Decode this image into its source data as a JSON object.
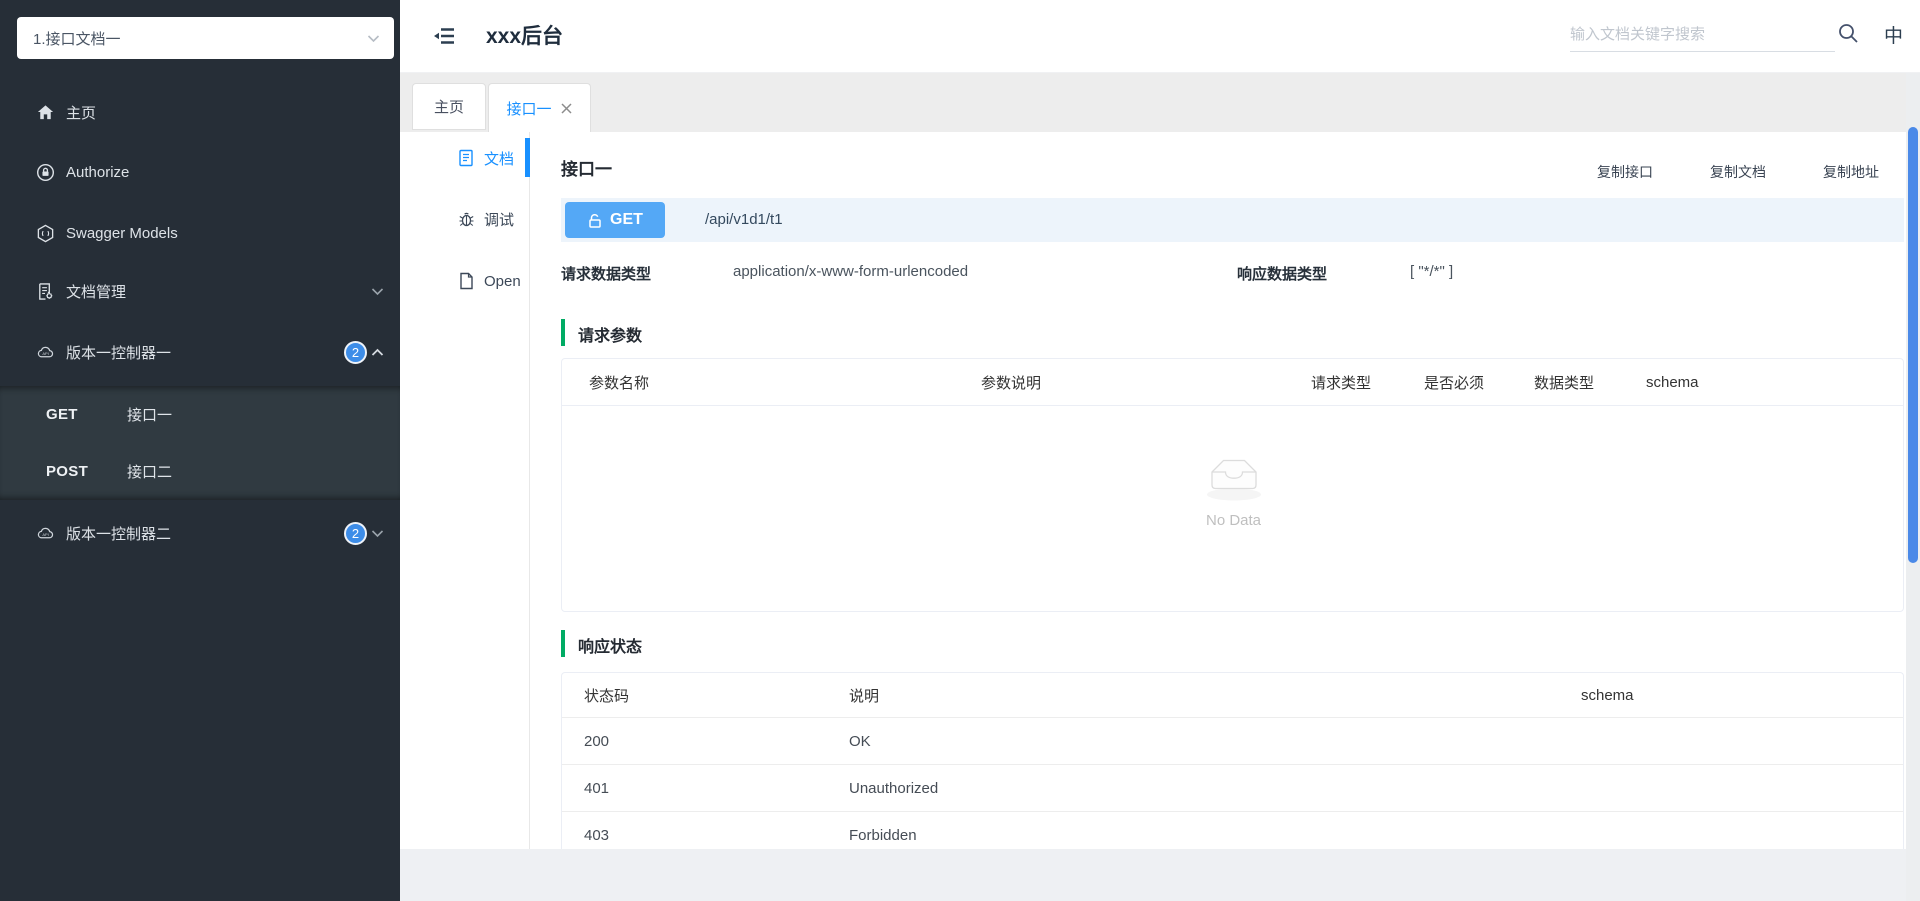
{
  "sidebar": {
    "selector_value": "1.接口文档一",
    "items": [
      {
        "label": "主页",
        "icon": "home-icon"
      },
      {
        "label": "Authorize",
        "icon": "lock-icon"
      },
      {
        "label": "Swagger Models",
        "icon": "models-hexagon-icon"
      },
      {
        "label": "文档管理",
        "icon": "doc-settings-icon",
        "chevron": "down"
      },
      {
        "label": "版本一控制器一",
        "icon": "api-cloud-icon",
        "badge": "2",
        "chevron": "up"
      },
      {
        "label": "版本一控制器二",
        "icon": "api-cloud-icon",
        "badge": "2",
        "chevron": "down"
      }
    ],
    "submenu": [
      {
        "method": "GET",
        "label": "接口一"
      },
      {
        "method": "POST",
        "label": "接口二"
      }
    ]
  },
  "header": {
    "title": "xxx后台",
    "menu_fold_icon": "fold-menu-icon",
    "search_placeholder": "输入文档关键字搜索",
    "search_icon": "search-icon",
    "lang": "中"
  },
  "tabs": [
    {
      "label": "主页",
      "active": false
    },
    {
      "label": "接口一",
      "active": true,
      "closable": true
    }
  ],
  "doc_sidebar": [
    {
      "label": "文档",
      "icon": "document-icon",
      "active": true
    },
    {
      "label": "调试",
      "icon": "bug-icon",
      "active": false
    },
    {
      "label": "Open",
      "icon": "file-icon",
      "active": false
    }
  ],
  "api": {
    "title": "接口一",
    "actions": [
      "复制接口",
      "复制文档",
      "复制地址"
    ],
    "method": "GET",
    "method_lock_icon": "unlock-icon",
    "path": "/api/v1d1/t1",
    "request_type_label": "请求数据类型",
    "request_type": "application/x-www-form-urlencoded",
    "response_type_label": "响应数据类型",
    "response_type": "[ \"*/*\" ]",
    "params_section": "请求参数",
    "params_headers": [
      "参数名称",
      "参数说明",
      "请求类型",
      "是否必须",
      "数据类型",
      "schema"
    ],
    "empty_icon": "empty-inbox-icon",
    "empty_text": "No Data",
    "status_section": "响应状态",
    "status_headers": [
      "状态码",
      "说明",
      "schema"
    ],
    "status_rows": [
      {
        "code": "200",
        "desc": "OK",
        "schema": ""
      },
      {
        "code": "401",
        "desc": "Unauthorized",
        "schema": ""
      },
      {
        "code": "403",
        "desc": "Forbidden",
        "schema": ""
      }
    ]
  },
  "colors": {
    "accent_blue": "#1890ff",
    "get_badge_blue": "#54a8f6",
    "get_row_bg": "#edf4fb",
    "section_marker_green": "#00ab64",
    "sidebar_bg": "#262e37",
    "sidebar_submenu_bg": "#303a41",
    "sidebar_badge_blue": "#3d8de8",
    "scrollbar_thumb_blue": "#4a89e8"
  }
}
